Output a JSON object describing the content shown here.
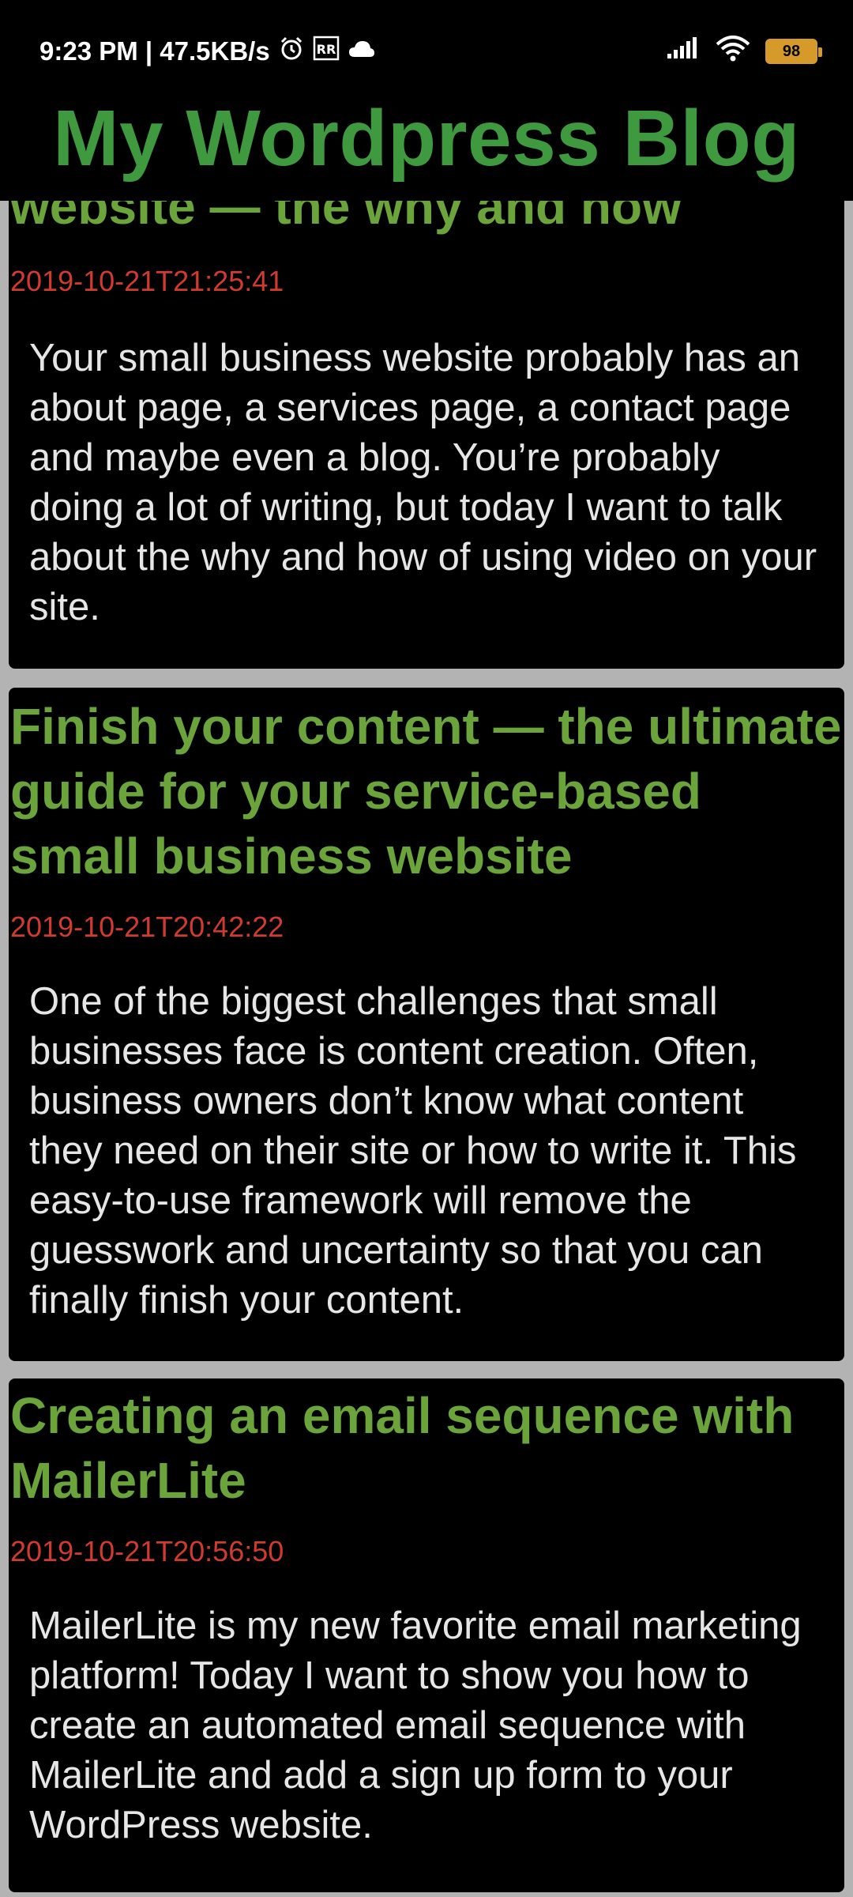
{
  "status_bar": {
    "time_speed": "9:23 PM | 47.5KB/s",
    "battery": "98",
    "icons": [
      "alarm-icon",
      "rr-icon",
      "cloud-icon",
      "signal-icon",
      "wifi-icon",
      "battery-icon"
    ]
  },
  "app": {
    "title": "My Wordpress Blog"
  },
  "colors": {
    "header_title": "#3f9a3f",
    "post_title": "#6aa43a",
    "post_date": "#d13b2f",
    "post_text": "#e6e6e6",
    "card_bg": "#000000",
    "page_bg": "#b3b3b3"
  },
  "posts": [
    {
      "title": "website — the why and how",
      "date": "2019-10-21T21:25:41",
      "excerpt": "Your small business website probably has an about page, a services page, a contact page and maybe even a blog. You’re probably doing a lot of writing, but today I want to talk about the why and how of using video on your site."
    },
    {
      "title": "Finish your content — the ultimate guide for your service-based small business website",
      "date": "2019-10-21T20:42:22",
      "excerpt": "One of the biggest challenges that small businesses face is content creation. Often, business owners don’t know what content they need on their site or how to write it. This easy-to-use framework will remove the guesswork and uncertainty so that you can finally finish your content."
    },
    {
      "title": "Creating an email sequence with MailerLite",
      "date": "2019-10-21T20:56:50",
      "excerpt": "MailerLite is my new favorite email marketing platform! Today I want to show you how to create an automated email sequence with MailerLite and add a sign up form to your WordPress website."
    }
  ]
}
